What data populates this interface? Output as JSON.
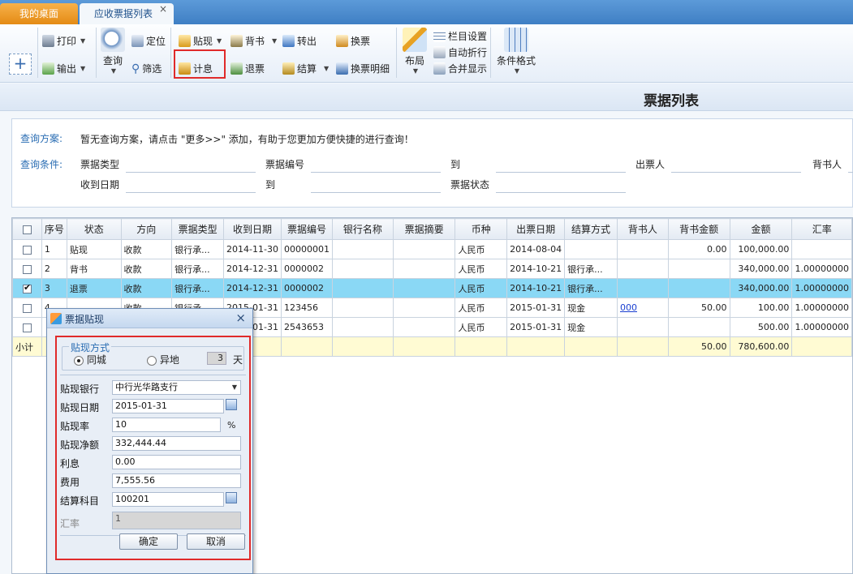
{
  "tabs": {
    "home": "我的桌面",
    "list": "应收票据列表",
    "close": "×"
  },
  "toolbar": {
    "add": "+",
    "print": "打印",
    "export": "输出",
    "query": "查询",
    "locate": "定位",
    "filter": "筛选",
    "discount": "贴现",
    "endorse": "背书",
    "transfer": "转出",
    "exchange": "换票",
    "interest": "计息",
    "return": "退票",
    "settle": "结算",
    "exchange_detail": "换票明细",
    "layout": "布局",
    "column_settings": "栏目设置",
    "auto_wrap": "自动折行",
    "merge_display": "合并显示",
    "conditional_format": "条件格式"
  },
  "page_title": "票据列表",
  "query": {
    "scheme_label": "查询方案:",
    "scheme_text": "暂无查询方案，请点击 \"更多>>\" 添加，有助于您更加方便快捷的进行查询！",
    "cond_label": "查询条件:",
    "bill_type": "票据类型",
    "bill_no": "票据编号",
    "to": "到",
    "drawer": "出票人",
    "endorser": "背书人",
    "recv_date": "收到日期",
    "bill_status": "票据状态"
  },
  "grid": {
    "headers": [
      "",
      "序号",
      "状态",
      "方向",
      "票据类型",
      "收到日期",
      "票据编号",
      "银行名称",
      "票据摘要",
      "币种",
      "出票日期",
      "结算方式",
      "背书人",
      "背书金额",
      "金额",
      "汇率"
    ],
    "rows": [
      {
        "checked": false,
        "no": "1",
        "status": "贴现",
        "dir": "收款",
        "type": "银行承...",
        "recv": "2014-11-30",
        "billno": "00000001",
        "bank": "",
        "summary": "",
        "cur": "人民币",
        "issue": "2014-08-04",
        "settle": "",
        "endorser": "",
        "eamt": "0.00",
        "amt": "100,000.00",
        "rate": ""
      },
      {
        "checked": false,
        "no": "2",
        "status": "背书",
        "dir": "收款",
        "type": "银行承...",
        "recv": "2014-12-31",
        "billno": "0000002",
        "bank": "",
        "summary": "",
        "cur": "人民币",
        "issue": "2014-10-21",
        "settle": "银行承...",
        "endorser": "",
        "eamt": "",
        "amt": "340,000.00",
        "rate": "1.00000000"
      },
      {
        "checked": true,
        "no": "3",
        "status": "退票",
        "dir": "收款",
        "type": "银行承...",
        "recv": "2014-12-31",
        "billno": "0000002",
        "bank": "",
        "summary": "",
        "cur": "人民币",
        "issue": "2014-10-21",
        "settle": "银行承...",
        "endorser": "",
        "eamt": "",
        "amt": "340,000.00",
        "rate": "1.00000000"
      },
      {
        "checked": false,
        "no": "4",
        "status": "",
        "dir": "收款",
        "type": "银行承...",
        "recv": "2015-01-31",
        "billno": "123456",
        "bank": "",
        "summary": "",
        "cur": "人民币",
        "issue": "2015-01-31",
        "settle": "现金",
        "endorser": "000",
        "eamt": "50.00",
        "amt": "100.00",
        "rate": "1.00000000"
      },
      {
        "checked": false,
        "no": "",
        "status": "",
        "dir": "",
        "type": "",
        "recv": "2015-01-31",
        "billno": "2543653",
        "bank": "",
        "summary": "",
        "cur": "人民币",
        "issue": "2015-01-31",
        "settle": "现金",
        "endorser": "",
        "eamt": "",
        "amt": "500.00",
        "rate": "1.00000000"
      }
    ],
    "subtotal": {
      "label": "小计",
      "eamt": "50.00",
      "amt": "780,600.00"
    }
  },
  "dialog": {
    "title": "票据贴现",
    "close": "×",
    "method_legend": "贴现方式",
    "local": "同城",
    "remote": "异地",
    "days": "3",
    "days_unit": "天",
    "bank_label": "贴现银行",
    "bank": "中行光华路支行",
    "date_label": "贴现日期",
    "date": "2015-01-31",
    "rate_label": "贴现率",
    "rate": "10",
    "rate_unit": "%",
    "net_label": "贴现净额",
    "net": "332,444.44",
    "interest_label": "利息",
    "interest": "0.00",
    "fee_label": "费用",
    "fee": "7,555.56",
    "account_label": "结算科目",
    "account": "100201",
    "fx_label": "汇率",
    "fx": "1",
    "ok": "确定",
    "cancel": "取消"
  },
  "colors": {
    "tab_active": "#e48b15",
    "highlight_row": "#8ad8f5",
    "subtotal_row": "#fffbd3",
    "red_box": "#e02a2a",
    "link": "#1a3fd1"
  }
}
